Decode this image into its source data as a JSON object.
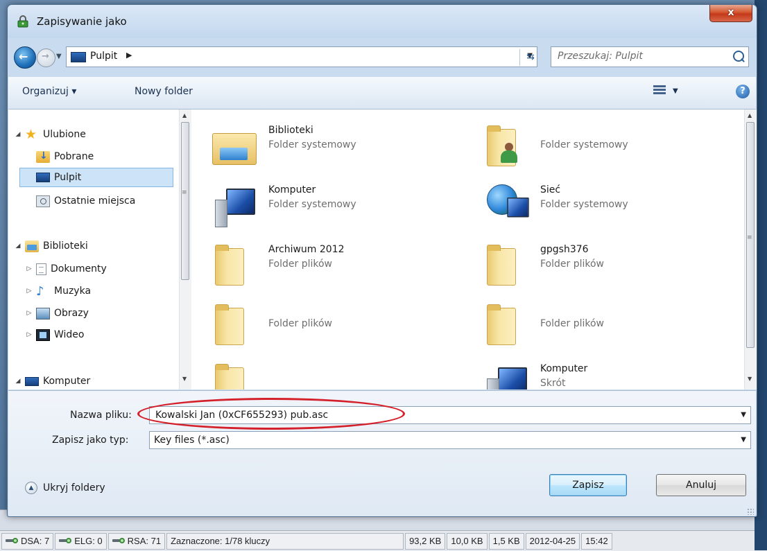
{
  "dialog": {
    "title": "Zapisywanie jako",
    "close_label": "x"
  },
  "address": {
    "location": "Pulpit",
    "search_placeholder": "Przeszukaj: Pulpit"
  },
  "toolbar": {
    "organize_label": "Organizuj ▾",
    "new_folder_label": "Nowy folder"
  },
  "nav": {
    "items": [
      {
        "label": "Ulubione",
        "icon": "star-icon"
      },
      {
        "label": "Pobrane",
        "icon": "downloads-folder-icon"
      },
      {
        "label": "Pulpit",
        "icon": "desktop-icon",
        "selected": true
      },
      {
        "label": "Ostatnie miejsca",
        "icon": "recent-places-icon"
      },
      {
        "label": "Biblioteki",
        "icon": "libraries-icon"
      },
      {
        "label": "Dokumenty",
        "icon": "documents-icon"
      },
      {
        "label": "Muzyka",
        "icon": "music-icon"
      },
      {
        "label": "Obrazy",
        "icon": "pictures-icon"
      },
      {
        "label": "Wideo",
        "icon": "video-icon"
      },
      {
        "label": "Komputer",
        "icon": "computer-icon"
      }
    ]
  },
  "files": {
    "items": [
      {
        "name": "Biblioteki",
        "type": "Folder systemowy",
        "icon": "libraries-icon"
      },
      {
        "name": "",
        "type": "Folder systemowy",
        "icon": "user-folder-icon"
      },
      {
        "name": "Komputer",
        "type": "Folder systemowy",
        "icon": "computer-icon"
      },
      {
        "name": "Sieć",
        "type": "Folder systemowy",
        "icon": "network-icon"
      },
      {
        "name": "Archiwum 2012",
        "type": "Folder plików",
        "icon": "folder-icon"
      },
      {
        "name": "gpgsh376",
        "type": "Folder plików",
        "icon": "folder-icon"
      },
      {
        "name": "",
        "type": "Folder plików",
        "icon": "folder-icon"
      },
      {
        "name": "",
        "type": "Folder plików",
        "icon": "folder-icon"
      },
      {
        "name": "",
        "type": "",
        "icon": "folder-icon"
      },
      {
        "name": "Komputer",
        "type": "Skrót",
        "icon": "computer-shortcut-icon"
      }
    ]
  },
  "form": {
    "filename_label": "Nazwa pliku:",
    "filename_value": "Kowalski Jan (0xCF655293) pub.asc",
    "type_label": "Zapisz jako typ:",
    "type_value": "Key files (*.asc)"
  },
  "buttons": {
    "hide_folders": "Ukryj foldery",
    "save": "Zapisz",
    "cancel": "Anuluj"
  },
  "statusbar": {
    "dsa": "DSA: 7",
    "elg": "ELG: 0",
    "rsa": "RSA: 71",
    "selected": "Zaznaczone: 1/78 kluczy",
    "size1": "93,2 KB",
    "size2": "10,0 KB",
    "size3": "1,5 KB",
    "date": "2012-04-25",
    "time": "15:42"
  },
  "colors": {
    "highlight_ellipse": "#d4202a",
    "selection": "#cce3f8",
    "close_button": "#c4391a"
  }
}
